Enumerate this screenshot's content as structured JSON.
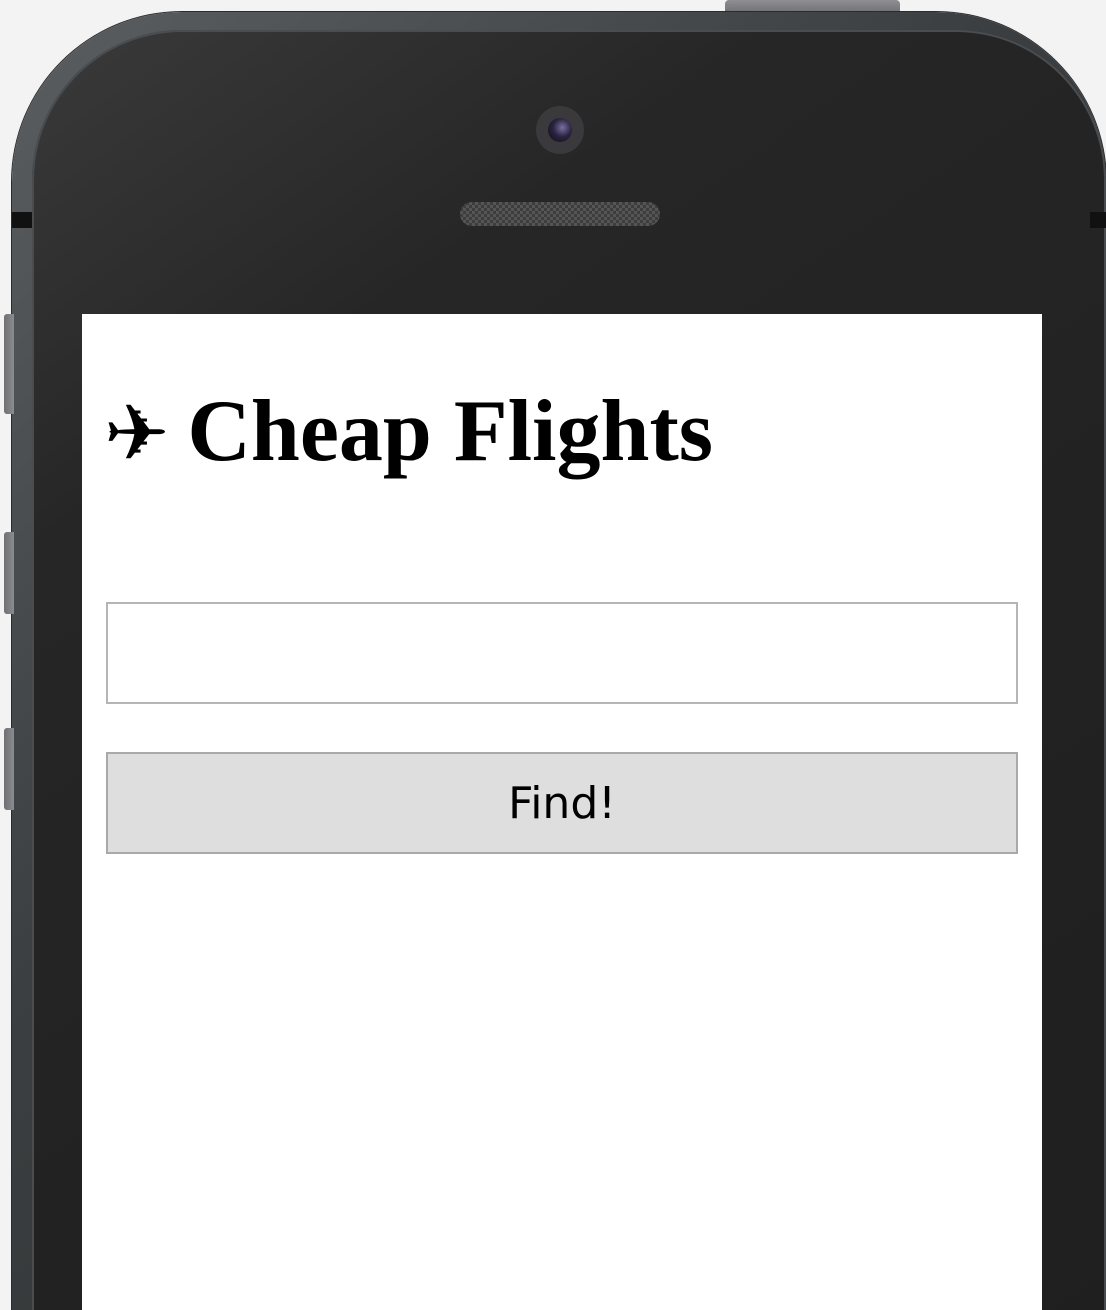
{
  "page": {
    "title_icon": "✈",
    "title_text": "Cheap Flights"
  },
  "search": {
    "value": "",
    "placeholder": ""
  },
  "actions": {
    "find_label": "Find!"
  },
  "icons": {
    "title_icon_name": "airplane-icon"
  },
  "colors": {
    "screen_background": "#ffffff",
    "button_background": "#dedede",
    "input_border": "#b5b5b5",
    "phone_bezel": "#222222"
  }
}
